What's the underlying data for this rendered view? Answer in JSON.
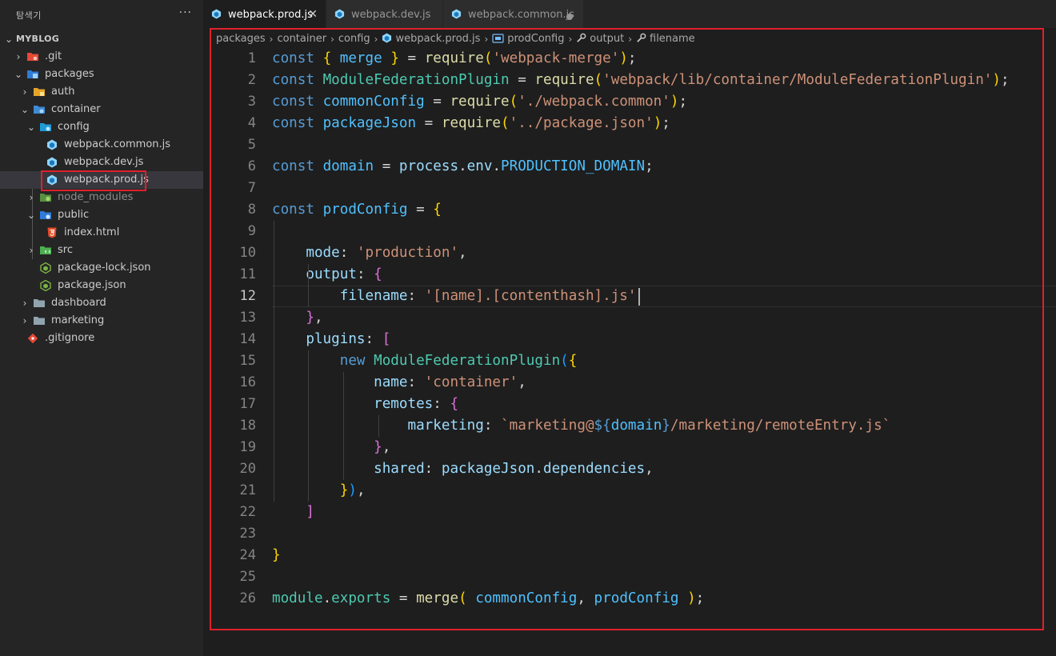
{
  "explorer": {
    "title": "탐색기",
    "more_label": "···",
    "root_label": "MYBLOG",
    "items": [
      {
        "label": ".git",
        "icon": "git-folder-icon"
      },
      {
        "label": "packages",
        "icon": "packages-folder-icon"
      },
      {
        "label": "auth",
        "icon": "auth-folder-icon"
      },
      {
        "label": "container",
        "icon": "folder-icon"
      },
      {
        "label": "config",
        "icon": "config-folder-icon"
      },
      {
        "label": "webpack.common.js",
        "icon": "webpack-icon"
      },
      {
        "label": "webpack.dev.js",
        "icon": "webpack-icon"
      },
      {
        "label": "webpack.prod.js",
        "icon": "webpack-icon"
      },
      {
        "label": "node_modules",
        "icon": "node-folder-icon"
      },
      {
        "label": "public",
        "icon": "public-folder-icon"
      },
      {
        "label": "index.html",
        "icon": "html5-icon"
      },
      {
        "label": "src",
        "icon": "src-folder-icon"
      },
      {
        "label": "package-lock.json",
        "icon": "nodejs-icon"
      },
      {
        "label": "package.json",
        "icon": "nodejs-icon"
      },
      {
        "label": "dashboard",
        "icon": "folder-icon"
      },
      {
        "label": "marketing",
        "icon": "folder-icon"
      },
      {
        "label": ".gitignore",
        "icon": "git-icon"
      }
    ]
  },
  "tabs": [
    {
      "label": "webpack.prod.js",
      "close": "✕",
      "active": true
    },
    {
      "label": "webpack.dev.js",
      "active": false
    },
    {
      "label": "webpack.common.js",
      "active": false,
      "modified": true
    }
  ],
  "breadcrumb": {
    "items": [
      "packages",
      "container",
      "config",
      "webpack.prod.js",
      "prodConfig",
      "output",
      "filename"
    ],
    "separator": "›"
  },
  "editor": {
    "line_numbers": [
      "1",
      "2",
      "3",
      "4",
      "5",
      "6",
      "7",
      "8",
      "9",
      "10",
      "11",
      "12",
      "13",
      "14",
      "15",
      "16",
      "17",
      "18",
      "19",
      "20",
      "21",
      "22",
      "23",
      "24",
      "25",
      "26"
    ],
    "current_line": 12,
    "lines": [
      [
        [
          "kw",
          "const"
        ],
        [
          "tx",
          " "
        ],
        [
          "b1",
          "{"
        ],
        [
          "tx",
          " "
        ],
        [
          "vr",
          "merge"
        ],
        [
          "tx",
          " "
        ],
        [
          "b1",
          "}"
        ],
        [
          "tx",
          " = "
        ],
        [
          "fn",
          "require"
        ],
        [
          "b1",
          "("
        ],
        [
          "st",
          "'webpack-merge'"
        ],
        [
          "b1",
          ")"
        ],
        [
          "tx",
          ";"
        ]
      ],
      [
        [
          "kw",
          "const"
        ],
        [
          "tx",
          " "
        ],
        [
          "ty",
          "ModuleFederationPlugin"
        ],
        [
          "tx",
          " = "
        ],
        [
          "fn",
          "require"
        ],
        [
          "b1",
          "("
        ],
        [
          "st",
          "'webpack/lib/container/ModuleFederationPlugin'"
        ],
        [
          "b1",
          ")"
        ],
        [
          "tx",
          ";"
        ]
      ],
      [
        [
          "kw",
          "const"
        ],
        [
          "tx",
          " "
        ],
        [
          "vr",
          "commonConfig"
        ],
        [
          "tx",
          " = "
        ],
        [
          "fn",
          "require"
        ],
        [
          "b1",
          "("
        ],
        [
          "st",
          "'./webpack.common'"
        ],
        [
          "b1",
          ")"
        ],
        [
          "tx",
          ";"
        ]
      ],
      [
        [
          "kw",
          "const"
        ],
        [
          "tx",
          " "
        ],
        [
          "vr",
          "packageJson"
        ],
        [
          "tx",
          " = "
        ],
        [
          "fn",
          "require"
        ],
        [
          "b1",
          "("
        ],
        [
          "st",
          "'../package.json'"
        ],
        [
          "b1",
          ")"
        ],
        [
          "tx",
          ";"
        ]
      ],
      [],
      [
        [
          "kw",
          "const"
        ],
        [
          "tx",
          " "
        ],
        [
          "vr",
          "domain"
        ],
        [
          "tx",
          " = "
        ],
        [
          "pr",
          "process"
        ],
        [
          "tx",
          "."
        ],
        [
          "pr",
          "env"
        ],
        [
          "tx",
          "."
        ],
        [
          "vr",
          "PRODUCTION_DOMAIN"
        ],
        [
          "tx",
          ";"
        ]
      ],
      [],
      [
        [
          "kw",
          "const"
        ],
        [
          "tx",
          " "
        ],
        [
          "vr",
          "prodConfig"
        ],
        [
          "tx",
          " = "
        ],
        [
          "b1",
          "{"
        ]
      ],
      [],
      [
        [
          "tx",
          "    "
        ],
        [
          "pr",
          "mode"
        ],
        [
          "tx",
          ": "
        ],
        [
          "st",
          "'production'"
        ],
        [
          "tx",
          ","
        ]
      ],
      [
        [
          "tx",
          "    "
        ],
        [
          "pr",
          "output"
        ],
        [
          "tx",
          ": "
        ],
        [
          "b2",
          "{"
        ]
      ],
      [
        [
          "tx",
          "        "
        ],
        [
          "pr",
          "filename"
        ],
        [
          "tx",
          ": "
        ],
        [
          "st",
          "'[name].[contenthash].js'"
        ]
      ],
      [
        [
          "tx",
          "    "
        ],
        [
          "b2",
          "}"
        ],
        [
          "tx",
          ","
        ]
      ],
      [
        [
          "tx",
          "    "
        ],
        [
          "pr",
          "plugins"
        ],
        [
          "tx",
          ": "
        ],
        [
          "b2",
          "["
        ]
      ],
      [
        [
          "tx",
          "        "
        ],
        [
          "kw",
          "new"
        ],
        [
          "tx",
          " "
        ],
        [
          "ty",
          "ModuleFederationPlugin"
        ],
        [
          "b3",
          "("
        ],
        [
          "b1",
          "{"
        ]
      ],
      [
        [
          "tx",
          "            "
        ],
        [
          "pr",
          "name"
        ],
        [
          "tx",
          ": "
        ],
        [
          "st",
          "'container'"
        ],
        [
          "tx",
          ","
        ]
      ],
      [
        [
          "tx",
          "            "
        ],
        [
          "pr",
          "remotes"
        ],
        [
          "tx",
          ": "
        ],
        [
          "b2",
          "{"
        ]
      ],
      [
        [
          "tx",
          "                "
        ],
        [
          "pr",
          "marketing"
        ],
        [
          "tx",
          ": "
        ],
        [
          "st",
          "`marketing@"
        ],
        [
          "kw",
          "${"
        ],
        [
          "vr",
          "domain"
        ],
        [
          "kw",
          "}"
        ],
        [
          "st",
          "/marketing/remoteEntry.js`"
        ]
      ],
      [
        [
          "tx",
          "            "
        ],
        [
          "b2",
          "}"
        ],
        [
          "tx",
          ","
        ]
      ],
      [
        [
          "tx",
          "            "
        ],
        [
          "pr",
          "shared"
        ],
        [
          "tx",
          ": "
        ],
        [
          "pr",
          "packageJson"
        ],
        [
          "tx",
          "."
        ],
        [
          "pr",
          "dependencies"
        ],
        [
          "tx",
          ","
        ]
      ],
      [
        [
          "tx",
          "        "
        ],
        [
          "b1",
          "}"
        ],
        [
          "b3",
          ")"
        ],
        [
          "tx",
          ","
        ]
      ],
      [
        [
          "tx",
          "    "
        ],
        [
          "b2",
          "]"
        ]
      ],
      [],
      [
        [
          "b1",
          "}"
        ]
      ],
      [],
      [
        [
          "ty",
          "module"
        ],
        [
          "tx",
          "."
        ],
        [
          "ty",
          "exports"
        ],
        [
          "tx",
          " = "
        ],
        [
          "fn",
          "merge"
        ],
        [
          "b1",
          "("
        ],
        [
          "tx",
          " "
        ],
        [
          "vr",
          "commonConfig"
        ],
        [
          "tx",
          ", "
        ],
        [
          "vr",
          "prodConfig"
        ],
        [
          "tx",
          " "
        ],
        [
          "b1",
          ")"
        ],
        [
          "tx",
          ";"
        ]
      ]
    ]
  },
  "colors": {
    "background": "#1e1e1e",
    "sidebar": "#252526",
    "highlight_border": "#e0202a"
  }
}
